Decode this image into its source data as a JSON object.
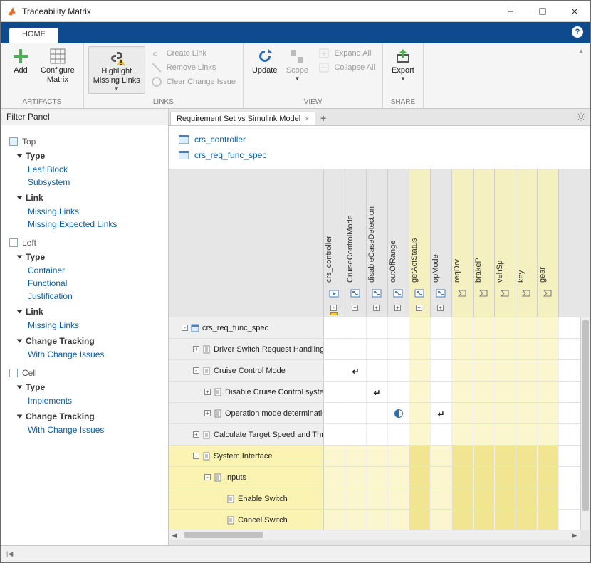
{
  "window": {
    "title": "Traceability Matrix"
  },
  "ribbon": {
    "home_tab": "HOME",
    "artifacts": {
      "add": "Add",
      "configure": "Configure\nMatrix",
      "group": "ARTIFACTS"
    },
    "links": {
      "highlight": "Highlight\nMissing Links",
      "create": "Create Link",
      "remove": "Remove Links",
      "clear": "Clear Change Issue",
      "group": "LINKS"
    },
    "view": {
      "update": "Update",
      "scope": "Scope",
      "expand": "Expand All",
      "collapse": "Collapse All",
      "group": "VIEW"
    },
    "share": {
      "export": "Export",
      "group": "SHARE"
    }
  },
  "filter_panel": {
    "header": "Filter Panel",
    "top": "Top",
    "left": "Left",
    "cell": "Cell",
    "type": "Type",
    "link": "Link",
    "change_tracking": "Change Tracking",
    "top_type": {
      "leaf_block": "Leaf Block",
      "subsystem": "Subsystem"
    },
    "top_link": {
      "missing_links": "Missing Links",
      "missing_expected": "Missing Expected Links"
    },
    "left_type": {
      "container": "Container",
      "functional": "Functional",
      "justification": "Justification"
    },
    "left_link": {
      "missing_links": "Missing Links"
    },
    "left_ct": {
      "with_issues": "With Change Issues"
    },
    "cell_type": {
      "implements": "Implements"
    },
    "cell_ct": {
      "with_issues": "With Change Issues"
    }
  },
  "doc_tab": "Requirement Set vs Simulink Model",
  "artifacts": {
    "top": "crs_controller",
    "left": "crs_req_func_spec"
  },
  "columns": [
    {
      "label": "crs_controller",
      "kind": "model",
      "highlight": false,
      "expand": "-",
      "mark": true
    },
    {
      "label": "CruiseControlMode",
      "kind": "chart",
      "highlight": false,
      "expand": "+"
    },
    {
      "label": "disableCaseDetection",
      "kind": "chart",
      "highlight": false,
      "expand": "+"
    },
    {
      "label": "outOfRange",
      "kind": "chart",
      "highlight": false,
      "expand": "+"
    },
    {
      "label": "getActStatus",
      "kind": "chart",
      "highlight": true,
      "expand": "+"
    },
    {
      "label": "opMode",
      "kind": "chart",
      "highlight": false,
      "expand": "+"
    },
    {
      "label": "reqDrv",
      "kind": "inport",
      "highlight": true
    },
    {
      "label": "brakeP",
      "kind": "inport",
      "highlight": true
    },
    {
      "label": "vehSp",
      "kind": "inport",
      "highlight": true
    },
    {
      "label": "key",
      "kind": "inport",
      "highlight": true
    },
    {
      "label": "gear",
      "kind": "inport",
      "highlight": true
    }
  ],
  "rows": [
    {
      "label": "crs_req_func_spec",
      "indent": 0,
      "tw": "-",
      "root": true
    },
    {
      "label": "Driver Switch Request Handling",
      "indent": 1,
      "tw": "+"
    },
    {
      "label": "Cruise Control Mode",
      "indent": 1,
      "tw": "-",
      "cells": {
        "1": "arrow"
      }
    },
    {
      "label": "Disable Cruise Control system",
      "indent": 2,
      "tw": "+",
      "cells": {
        "2": "arrow"
      }
    },
    {
      "label": "Operation mode determination",
      "indent": 2,
      "tw": "+",
      "cells": {
        "3": "half",
        "5": "arrow"
      }
    },
    {
      "label": "Calculate Target Speed and Throttle",
      "indent": 1,
      "tw": "+"
    },
    {
      "label": "System Interface",
      "indent": 1,
      "tw": "-",
      "highlight": true
    },
    {
      "label": "Inputs",
      "indent": 2,
      "tw": "-",
      "highlight": true
    },
    {
      "label": "Enable Switch",
      "indent": 3,
      "tw": "",
      "highlight": true
    },
    {
      "label": "Cancel Switch",
      "indent": 3,
      "tw": "",
      "highlight": true
    }
  ],
  "chart_data": {
    "type": "table",
    "title": "Requirement Set vs Simulink Model",
    "columns": [
      "crs_controller",
      "CruiseControlMode",
      "disableCaseDetection",
      "outOfRange",
      "getActStatus",
      "opMode",
      "reqDrv",
      "brakeP",
      "vehSp",
      "key",
      "gear"
    ],
    "rows": [
      "crs_req_func_spec",
      "Driver Switch Request Handling",
      "Cruise Control Mode",
      "Disable Cruise Control system",
      "Operation mode determination",
      "Calculate Target Speed and Throttle",
      "System Interface",
      "Inputs",
      "Enable Switch",
      "Cancel Switch"
    ],
    "cells": [
      {
        "row": "Cruise Control Mode",
        "col": "CruiseControlMode",
        "mark": "link"
      },
      {
        "row": "Disable Cruise Control system",
        "col": "disableCaseDetection",
        "mark": "link"
      },
      {
        "row": "Operation mode determination",
        "col": "outOfRange",
        "mark": "change-issue"
      },
      {
        "row": "Operation mode determination",
        "col": "opMode",
        "mark": "link"
      }
    ],
    "highlighted_columns": [
      "getActStatus",
      "reqDrv",
      "brakeP",
      "vehSp",
      "key",
      "gear"
    ],
    "highlighted_rows": [
      "System Interface",
      "Inputs",
      "Enable Switch",
      "Cancel Switch"
    ]
  }
}
